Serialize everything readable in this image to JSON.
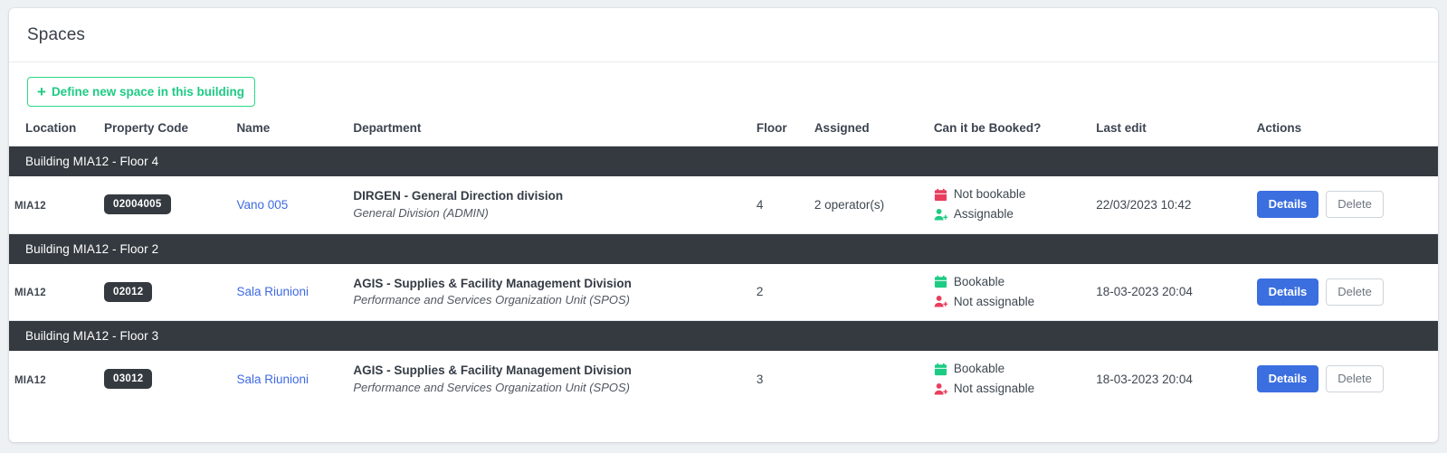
{
  "card": {
    "title": "Spaces"
  },
  "toolbar": {
    "define_label": "Define new space in this building",
    "define_icon": "plus-icon",
    "plus_glyph": "+"
  },
  "table": {
    "columns": [
      "Location",
      "Property Code",
      "Name",
      "Department",
      "Floor",
      "Assigned",
      "Can it be Booked?",
      "Last edit",
      "Actions"
    ],
    "groups": [
      {
        "label": "Building MIA12 - Floor 4",
        "rows": [
          {
            "location": "MIA12",
            "property_code": "02004005",
            "name": "Vano 005",
            "dept_main": "DIRGEN - General Direction division",
            "dept_sub": "General Division (ADMIN)",
            "floor": "4",
            "assigned": "2 operator(s)",
            "booking_label": "Not bookable",
            "booking_state": "not-bookable",
            "booking_color": "#e83e5c",
            "booking_icon": "calendar-icon",
            "assign_label": "Assignable",
            "assign_state": "assignable",
            "assign_color": "#1ecb83",
            "assign_icon": "person-plus-icon",
            "last_edit": "22/03/2023 10:42",
            "details_label": "Details",
            "delete_label": "Delete"
          }
        ]
      },
      {
        "label": "Building MIA12 - Floor 2",
        "rows": [
          {
            "location": "MIA12",
            "property_code": "02012",
            "name": "Sala Riunioni",
            "dept_main": "AGIS - Supplies & Facility Management Division",
            "dept_sub": "Performance and Services Organization Unit (SPOS)",
            "floor": "2",
            "assigned": "",
            "booking_label": "Bookable",
            "booking_state": "bookable",
            "booking_color": "#1ecb83",
            "booking_icon": "calendar-icon",
            "assign_label": "Not assignable",
            "assign_state": "not-assignable",
            "assign_color": "#e83e5c",
            "assign_icon": "person-plus-icon",
            "last_edit": "18-03-2023 20:04",
            "details_label": "Details",
            "delete_label": "Delete"
          }
        ]
      },
      {
        "label": "Building MIA12 - Floor 3",
        "rows": [
          {
            "location": "MIA12",
            "property_code": "03012",
            "name": "Sala Riunioni",
            "dept_main": "AGIS - Supplies & Facility Management Division",
            "dept_sub": "Performance and Services Organization Unit (SPOS)",
            "floor": "3",
            "assigned": "",
            "booking_label": "Bookable",
            "booking_state": "bookable",
            "booking_color": "#1ecb83",
            "booking_icon": "calendar-icon",
            "assign_label": "Not assignable",
            "assign_state": "not-assignable",
            "assign_color": "#e83e5c",
            "assign_icon": "person-plus-icon",
            "last_edit": "18-03-2023 20:04",
            "details_label": "Details",
            "delete_label": "Delete"
          }
        ]
      }
    ]
  },
  "colors": {
    "page_bg": "#eef1f4",
    "card_bg": "#ffffff",
    "group_header_bg": "#343a40",
    "accent_green": "#1ecb83",
    "accent_red": "#e83e5c",
    "accent_blue": "#3b6fe0",
    "link_blue": "#3e6ae1"
  }
}
